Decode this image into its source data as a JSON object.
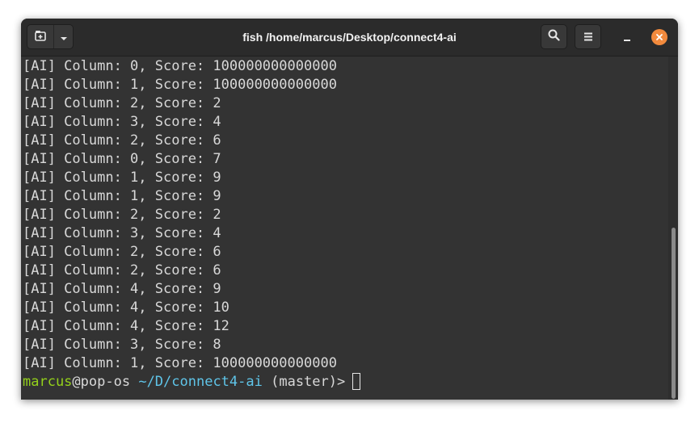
{
  "window": {
    "title": "fish /home/marcus/Desktop/connect4-ai"
  },
  "titlebar": {
    "new_tab_icon": "new-tab-icon",
    "menu_dropdown_icon": "chevron-down-icon",
    "search_icon": "search-icon",
    "hamburger_icon": "hamburger-menu-icon",
    "minimize_icon": "minimize-icon",
    "close_icon": "close-icon",
    "close_color": "#f28a3d"
  },
  "terminal": {
    "output_lines": [
      "[AI] Column: 0, Score: 100000000000000",
      "[AI] Column: 1, Score: 100000000000000",
      "[AI] Column: 2, Score: 2",
      "[AI] Column: 3, Score: 4",
      "[AI] Column: 2, Score: 6",
      "[AI] Column: 0, Score: 7",
      "[AI] Column: 1, Score: 9",
      "[AI] Column: 1, Score: 9",
      "[AI] Column: 2, Score: 2",
      "[AI] Column: 3, Score: 4",
      "[AI] Column: 2, Score: 6",
      "[AI] Column: 2, Score: 6",
      "[AI] Column: 4, Score: 9",
      "[AI] Column: 4, Score: 10",
      "[AI] Column: 4, Score: 12",
      "[AI] Column: 3, Score: 8",
      "[AI] Column: 1, Score: 100000000000000"
    ],
    "prompt": {
      "user": "marcus",
      "host": "@pop-os",
      "path": "~/D/connect4-ai",
      "branch": "(master)>",
      "user_color": "#94d11b",
      "path_color": "#5fc4e8"
    }
  }
}
